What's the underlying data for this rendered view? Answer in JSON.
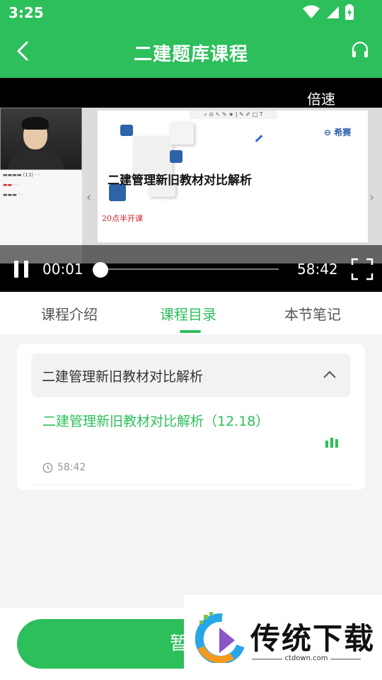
{
  "status": {
    "time": "3:25"
  },
  "header": {
    "title": "二建题库课程"
  },
  "player": {
    "speed_label": "倍速",
    "current_time": "00:01",
    "duration": "58:42",
    "progress": 0.0003,
    "slide": {
      "brand": "希赛",
      "title": "二建管理新旧教材对比解析",
      "subtitle": "20点半开课"
    }
  },
  "tabs": [
    {
      "label": "课程介绍"
    },
    {
      "label": "课程目录",
      "active": true
    },
    {
      "label": "本节笔记"
    }
  ],
  "chapter": {
    "title": "二建管理新旧教材对比解析",
    "lessons": [
      {
        "title": "二建管理新旧教材对比解析（12.18）",
        "duration": "58:42"
      }
    ]
  },
  "bottom": {
    "button_label": "暂停"
  },
  "watermark": {
    "name": "传统下载",
    "url": "ctdown.com"
  }
}
